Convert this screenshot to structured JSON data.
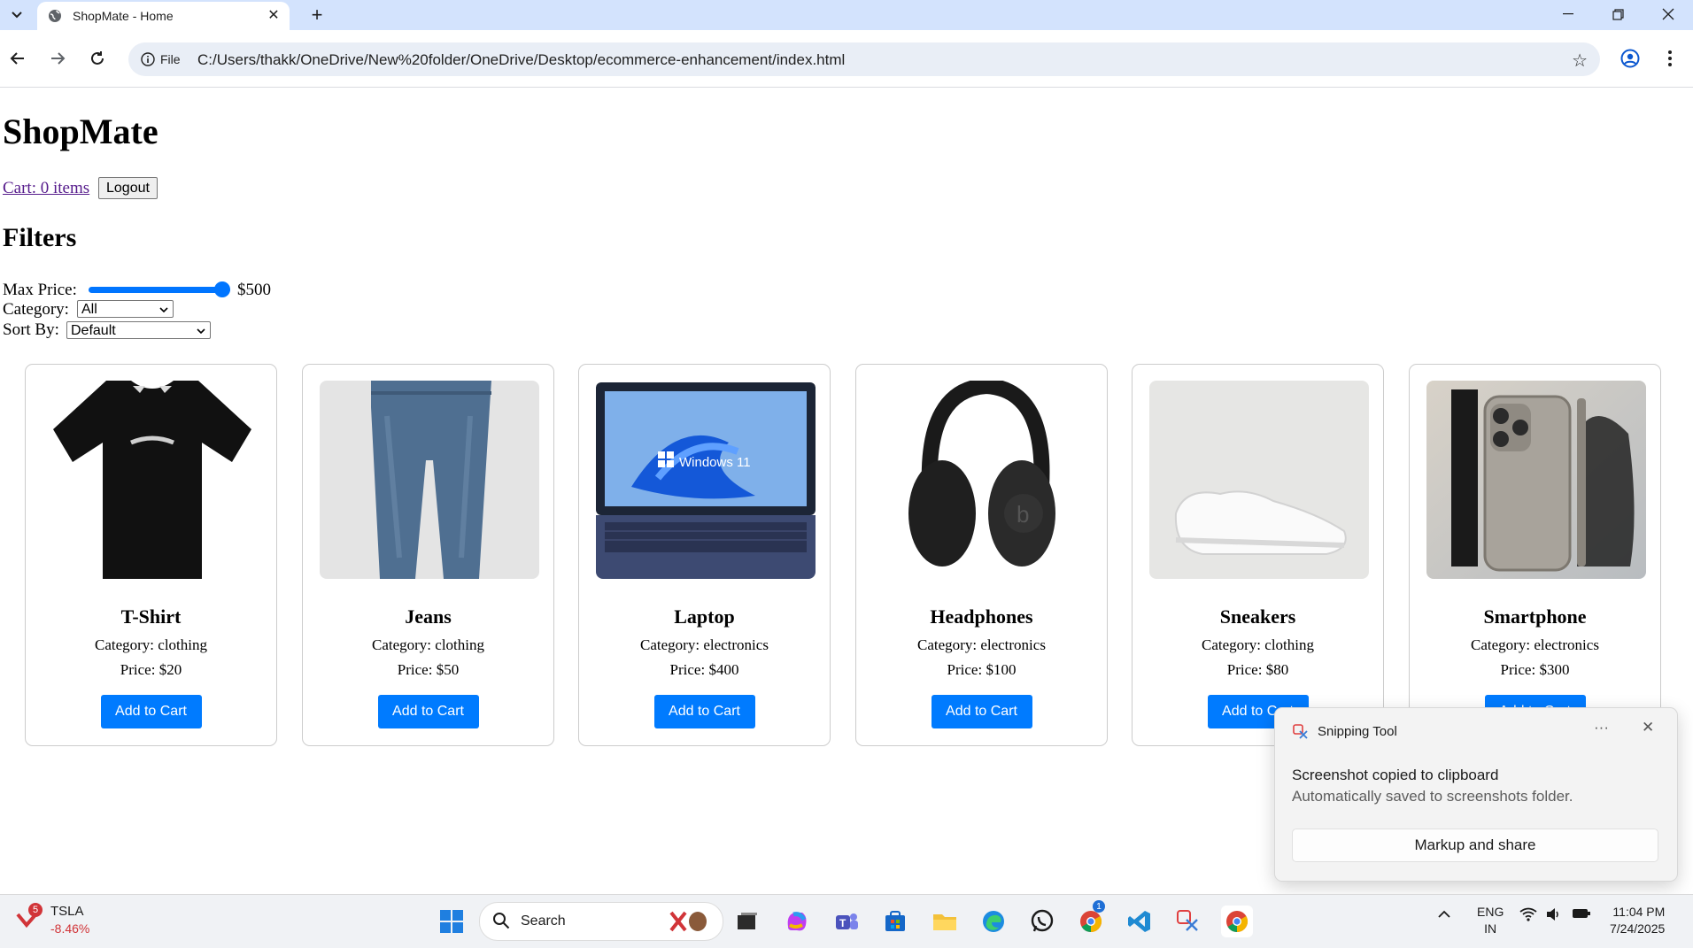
{
  "browser": {
    "tab_title": "ShopMate - Home",
    "url_chip": "File",
    "url": "C:/Users/thakk/OneDrive/New%20folder/OneDrive/Desktop/ecommerce-enhancement/index.html"
  },
  "page": {
    "title": "ShopMate",
    "cart_link": "Cart: 0 items",
    "logout": "Logout",
    "filters_heading": "Filters",
    "max_price_label": "Max Price:",
    "max_price_value": "$500",
    "max_price_fraction": 1.0,
    "category_label": "Category:",
    "category_selected": "All",
    "sort_label": "Sort By:",
    "sort_selected": "Default"
  },
  "products": [
    {
      "name": "T-Shirt",
      "category": "Category: clothing",
      "price": "Price: $20",
      "button": "Add to Cart",
      "icon": "tshirt-image"
    },
    {
      "name": "Jeans",
      "category": "Category: clothing",
      "price": "Price: $50",
      "button": "Add to Cart",
      "icon": "jeans-image"
    },
    {
      "name": "Laptop",
      "category": "Category: electronics",
      "price": "Price: $400",
      "button": "Add to Cart",
      "icon": "laptop-image",
      "screen_text": "Windows 11"
    },
    {
      "name": "Headphones",
      "category": "Category: electronics",
      "price": "Price: $100",
      "button": "Add to Cart",
      "icon": "headphones-image"
    },
    {
      "name": "Sneakers",
      "category": "Category: clothing",
      "price": "Price: $80",
      "button": "Add to Cart",
      "icon": "sneakers-image"
    },
    {
      "name": "Smartphone",
      "category": "Category: electronics",
      "price": "Price: $300",
      "button": "Add to Cart",
      "icon": "smartphone-image"
    }
  ],
  "toast": {
    "app": "Snipping Tool",
    "message": "Screenshot copied to clipboard",
    "detail": "Automatically saved to screenshots folder.",
    "action": "Markup and share"
  },
  "taskbar": {
    "stock_badge": "5",
    "stock_symbol": "TSLA",
    "stock_change": "-8.46%",
    "search_placeholder": "Search",
    "lang_top": "ENG",
    "lang_bottom": "IN",
    "time": "11:04 PM",
    "date": "7/24/2025",
    "chrome_badge": "1"
  },
  "colors": {
    "accent": "#007bff",
    "range": "#0075ff",
    "tabstrip": "#d3e3fd",
    "link_visited": "#551a8b",
    "stock_negative": "#d13438"
  }
}
